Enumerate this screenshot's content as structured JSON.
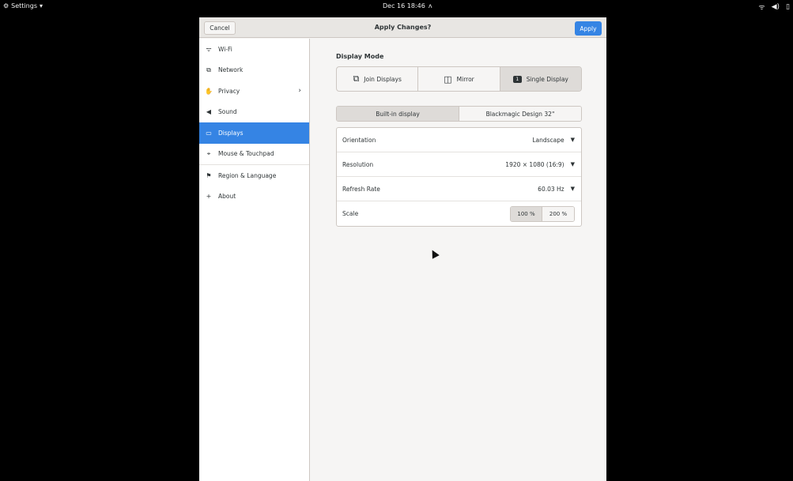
{
  "topbar": {
    "app_menu_label": "Settings",
    "app_menu_arrow": "▾",
    "clock": "Dec 16  18:46",
    "tray": {
      "wifi_icon": "ᯤ",
      "volume_icon": "◀)",
      "battery_icon": "▯"
    }
  },
  "headerbar": {
    "cancel_label": "Cancel",
    "title": "Apply Changes?",
    "apply_label": "Apply",
    "accent_color": "#3584e4"
  },
  "sidebar": {
    "items": [
      {
        "label": "Wi-Fi",
        "icon": "wifi-icon",
        "glyph": "ᯤ"
      },
      {
        "label": "Network",
        "icon": "network-icon",
        "glyph": "⧉"
      },
      {
        "label": "Privacy",
        "icon": "privacy-icon",
        "glyph": "✋",
        "chevron": "›"
      },
      {
        "label": "Sound",
        "icon": "sound-icon",
        "glyph": "◀"
      },
      {
        "label": "Displays",
        "icon": "display-icon",
        "glyph": "▭"
      },
      {
        "label": "Mouse & Touchpad",
        "icon": "mouse-icon",
        "glyph": "⌖"
      },
      {
        "label": "Region & Language",
        "icon": "flag-icon",
        "glyph": "⚑"
      },
      {
        "label": "About",
        "icon": "about-icon",
        "glyph": "+"
      }
    ]
  },
  "main": {
    "display_mode_title": "Display Mode",
    "modes": [
      {
        "label": "Join Displays",
        "glyph": "⧉"
      },
      {
        "label": "Mirror",
        "glyph": "◫"
      },
      {
        "label": "Single Display",
        "glyph": "1"
      }
    ],
    "displays": [
      "Built-in display",
      "Blackmagic Design 32\""
    ],
    "settings": {
      "orientation": {
        "label": "Orientation",
        "value": "Landscape"
      },
      "resolution": {
        "label": "Resolution",
        "value": "1920 × 1080 (16:9)"
      },
      "refresh_rate": {
        "label": "Refresh Rate",
        "value": "60.03 Hz"
      },
      "scale": {
        "label": "Scale",
        "options": [
          "100 %",
          "200 %"
        ]
      }
    },
    "dropdown_arrow": "▼"
  }
}
